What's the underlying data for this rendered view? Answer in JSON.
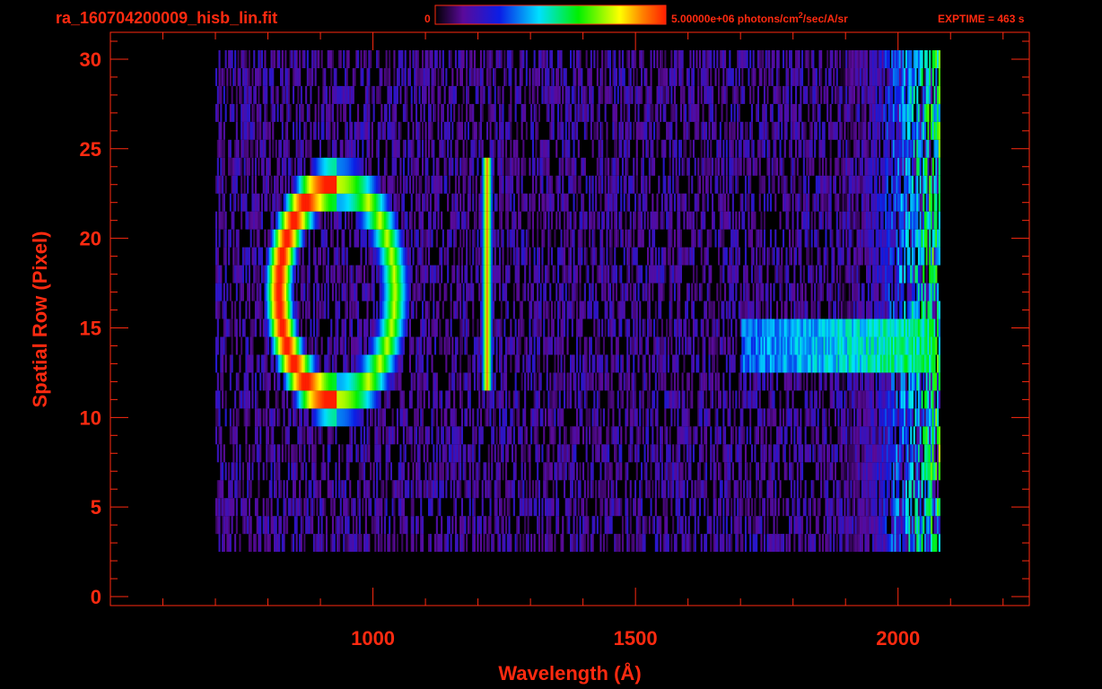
{
  "header": {
    "filename": "ra_160704200009_hisb_lin.fit",
    "colorbar_min": "0",
    "colorbar_max_prefix": "5.00000e+06 photons/cm",
    "colorbar_max_exp": "2",
    "colorbar_max_suffix": "/sec/A/sr",
    "exptime": "EXPTIME = 463 s"
  },
  "colors": {
    "axis": "#ff2a10",
    "background": "#000000",
    "colormap": [
      "#000000",
      "#5a0a9a",
      "#0a1ee6",
      "#00e0ff",
      "#00f000",
      "#ffff00",
      "#ff8000",
      "#ff1e00"
    ]
  },
  "chart_data": {
    "type": "heatmap",
    "title": "ra_160704200009_hisb_lin.fit",
    "xlabel": "Wavelength (Å)",
    "ylabel": "Spatial Row (Pixel)",
    "xlim": [
      500,
      2250
    ],
    "ylim": [
      -0.5,
      31.5
    ],
    "x_ticks": [
      1000,
      1500,
      2000
    ],
    "y_ticks": [
      0,
      5,
      10,
      15,
      20,
      25,
      30
    ],
    "x_tick_labels": [
      "1000",
      "1500",
      "2000"
    ],
    "y_tick_labels": [
      "0",
      "5",
      "10",
      "15",
      "20",
      "25",
      "30"
    ],
    "x_minor_step": 100,
    "y_minor_step": 1,
    "colorbar": {
      "min": 0,
      "max": 5000000,
      "units": "photons/cm^2/sec/A/sr"
    },
    "grid": false,
    "features": [
      {
        "kind": "bright_ring",
        "wavelength_range": [
          800,
          1060
        ],
        "rows": [
          10,
          24
        ],
        "peak_fraction": 0.9
      },
      {
        "kind": "emission_line",
        "wavelength": 1216,
        "rows": [
          12,
          24
        ],
        "peak_fraction": 0.6
      },
      {
        "kind": "horizontal_band",
        "wavelength_range": [
          1700,
          2070
        ],
        "rows": [
          13,
          15
        ],
        "peak_fraction": 0.5
      },
      {
        "kind": "detector_edge",
        "wavelength_range": [
          1960,
          2080
        ],
        "rows": [
          1,
          30
        ],
        "peak_fraction": 0.7
      }
    ]
  }
}
